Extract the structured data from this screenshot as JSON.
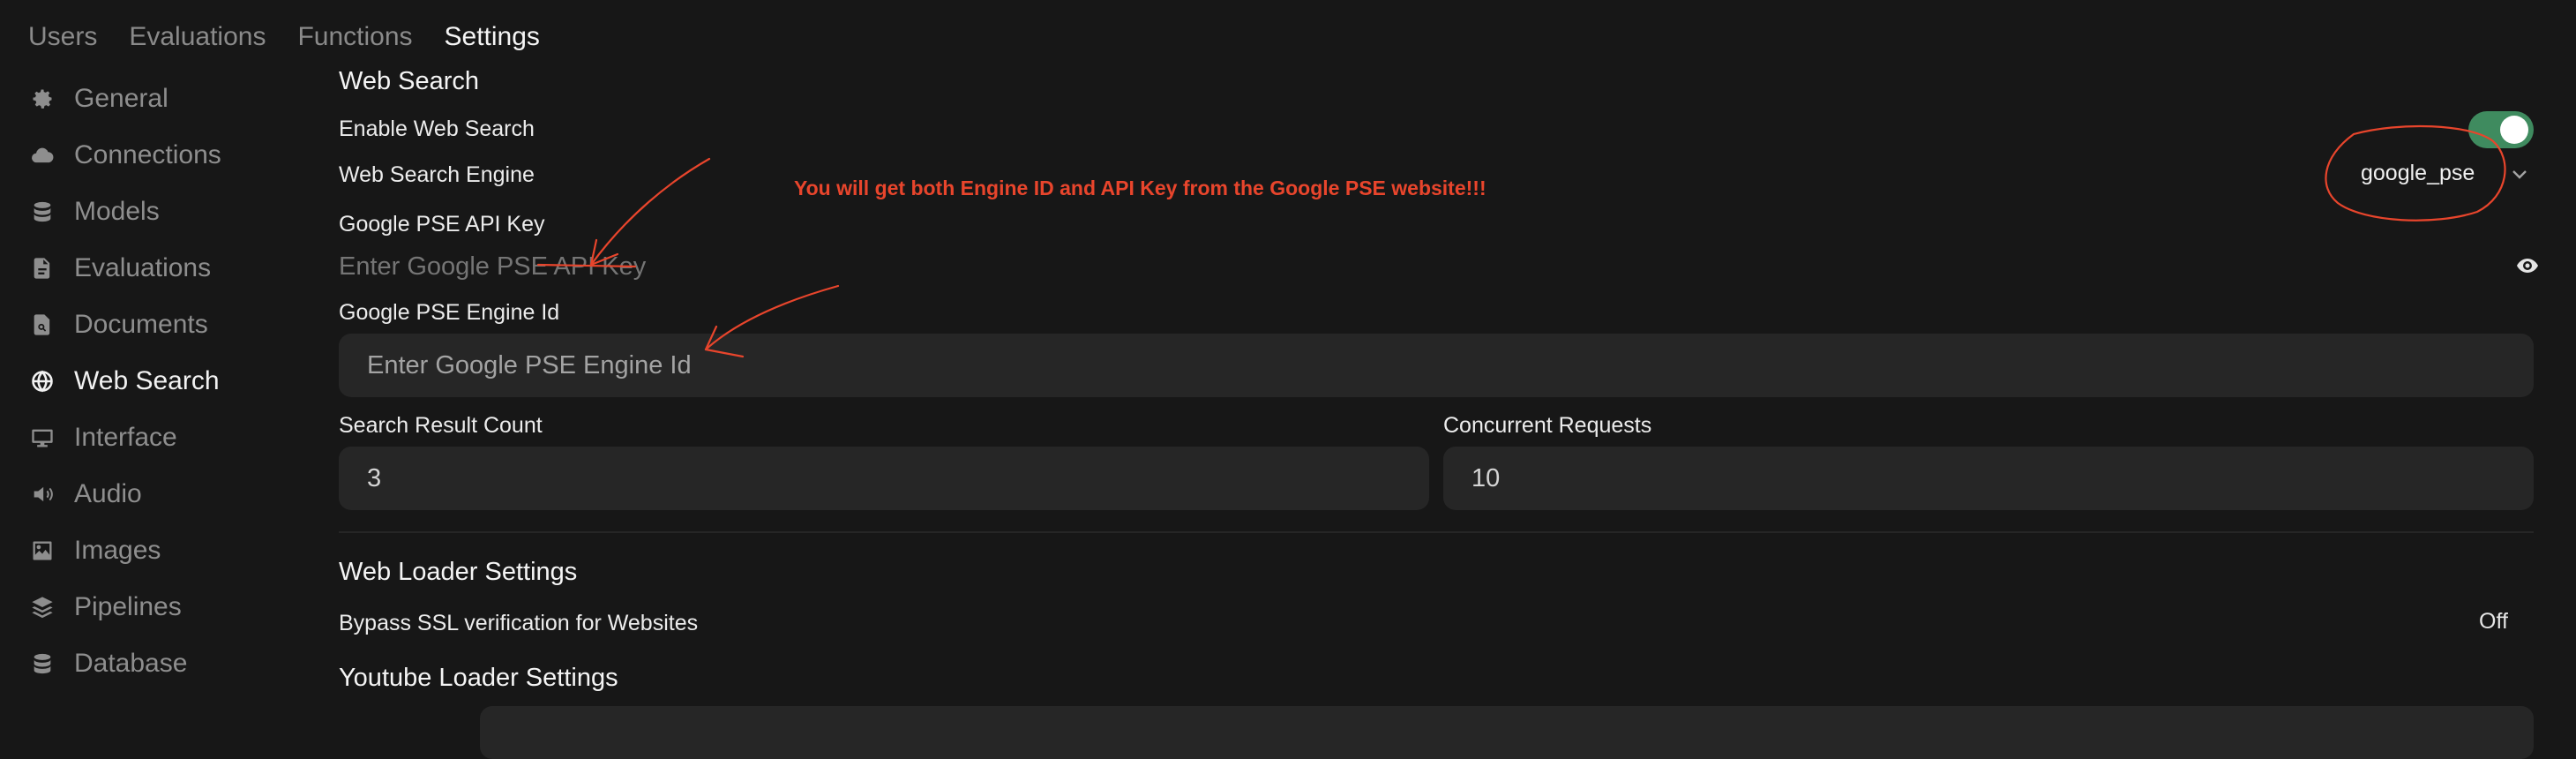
{
  "tabs": [
    "Users",
    "Evaluations",
    "Functions",
    "Settings"
  ],
  "active_tab": "Settings",
  "sidebar": {
    "items": [
      {
        "label": "General",
        "icon": "gear-icon"
      },
      {
        "label": "Connections",
        "icon": "cloud-icon"
      },
      {
        "label": "Models",
        "icon": "database-icon"
      },
      {
        "label": "Evaluations",
        "icon": "document-icon"
      },
      {
        "label": "Documents",
        "icon": "document-search-icon"
      },
      {
        "label": "Web Search",
        "icon": "globe-icon",
        "active": true
      },
      {
        "label": "Interface",
        "icon": "monitor-icon"
      },
      {
        "label": "Audio",
        "icon": "speaker-icon"
      },
      {
        "label": "Images",
        "icon": "image-icon"
      },
      {
        "label": "Pipelines",
        "icon": "layers-icon"
      },
      {
        "label": "Database",
        "icon": "database-icon"
      }
    ]
  },
  "main": {
    "title": "Web Search",
    "enable_label": "Enable Web Search",
    "enable_state": true,
    "engine_label": "Web Search Engine",
    "engine_value": "google_pse",
    "annotation": "You will get both Engine ID and API Key from the Google PSE website!!!",
    "api_key_label": "Google PSE API Key",
    "api_key_placeholder": "Enter Google PSE API Key",
    "engine_id_label": "Google PSE Engine Id",
    "engine_id_placeholder": "Enter Google PSE Engine Id",
    "result_count_label": "Search Result Count",
    "result_count_value": "3",
    "concurrent_label": "Concurrent Requests",
    "concurrent_value": "10",
    "loader_title": "Web Loader Settings",
    "bypass_label": "Bypass SSL verification for Websites",
    "bypass_value": "Off",
    "youtube_title": "Youtube Loader Settings"
  },
  "colors": {
    "background": "#171717",
    "input_bg": "#262626",
    "toggle_on": "#3f8b5f",
    "annotation": "#e8452c"
  }
}
